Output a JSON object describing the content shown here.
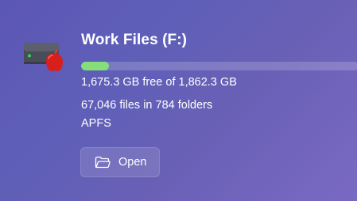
{
  "drive": {
    "title": "Work Files (F:)",
    "used_fraction": 0.1,
    "free_text": "1,675.3 GB free of 1,862.3 GB",
    "files_text": "67,046 files in 784 folders",
    "filesystem": "APFS",
    "icon": "external-drive-with-apple-icon"
  },
  "actions": {
    "open_label": "Open",
    "open_icon": "folder-open-icon"
  },
  "colors": {
    "progress_fill": "#86de7a",
    "drive_status_light": "#38d44f",
    "apple_badge": "#d91e1e"
  }
}
